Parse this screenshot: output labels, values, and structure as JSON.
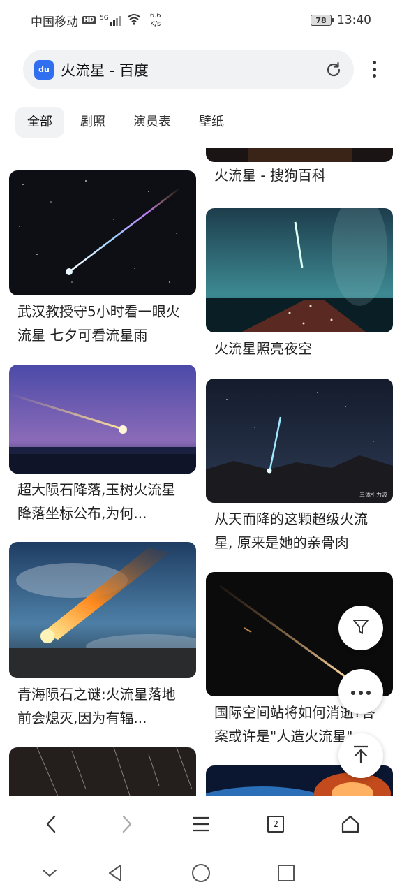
{
  "status_bar": {
    "carrier": "中国移动",
    "hd": "HD",
    "signal": "5G",
    "net_speed_value": "6.6",
    "net_speed_unit": "K/s",
    "battery": "78",
    "time": "13:40"
  },
  "search": {
    "logo_text": "du",
    "query": "火流星 - 百度"
  },
  "tabs": [
    {
      "label": "全部",
      "active": true
    },
    {
      "label": "剧照",
      "active": false
    },
    {
      "label": "演员表",
      "active": false
    },
    {
      "label": "壁纸",
      "active": false
    }
  ],
  "results": {
    "left": [
      {
        "title": "武汉教授守5小时看一眼火流星 七夕可看流星雨"
      },
      {
        "title": "超大陨石降落,玉树火流星降落坐标公布,为何..."
      },
      {
        "title": "青海陨石之谜:火流星落地前会熄灭,因为有辐..."
      }
    ],
    "right": [
      {
        "title": "火流星 - 搜狗百科"
      },
      {
        "title": "火流星照亮夜空"
      },
      {
        "title": "从天而降的这颗超级火流星, 原来是她的亲骨肉",
        "watermark": "三体引力波"
      },
      {
        "title": "国际空间站将如何消逝?答案或许是\"人造火流星\""
      }
    ]
  },
  "bottom_nav": {
    "tab_count": "2"
  }
}
